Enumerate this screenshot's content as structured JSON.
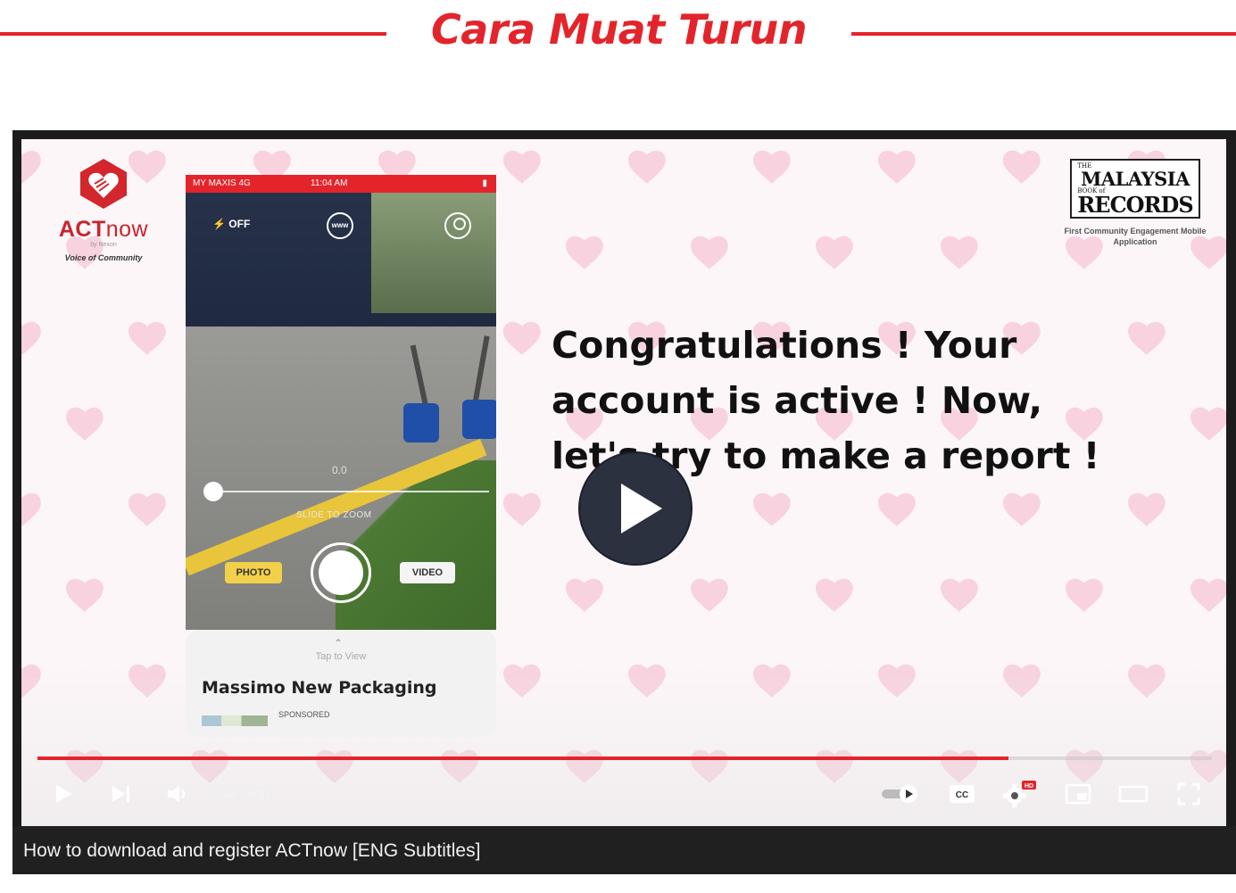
{
  "heading": {
    "text": "Cara Muat Turun",
    "color": "#e3242b"
  },
  "video": {
    "title": "How to download and register ACTnow [ENG Subtitles]",
    "logo": {
      "name_light": "ACT",
      "name_rest": "now",
      "tagline": "Voice of Community",
      "by": "by Nexon"
    },
    "badge": {
      "small": "THE",
      "main": "MALAYSIA",
      "records": "RECORDS",
      "book": "BOOK of",
      "caption": "First Community Engagement Mobile Application"
    },
    "phone": {
      "status": {
        "carrier": "MY MAXIS 4G",
        "time": "11:04 AM",
        "battery": "▮"
      },
      "flash": "OFF",
      "www": "www",
      "zoom_value": "0.0",
      "zoom_label": "SLIDE TO ZOOM",
      "photo_label": "PHOTO",
      "video_label": "VIDEO",
      "ad": {
        "tap": "Tap to View",
        "title": "Massimo New Packaging",
        "sponsored": "SPONSORED"
      }
    },
    "overlay_text": "Congratulations ! Your account is active ! Now, let's try to make a report !",
    "player": {
      "current_time": "3:44",
      "duration": "4:31",
      "time_display": "3:44 / 4:31",
      "progress": 0.8266,
      "quality_badge": "HD",
      "cc_label": "CC",
      "accent": "#e3242b"
    }
  }
}
